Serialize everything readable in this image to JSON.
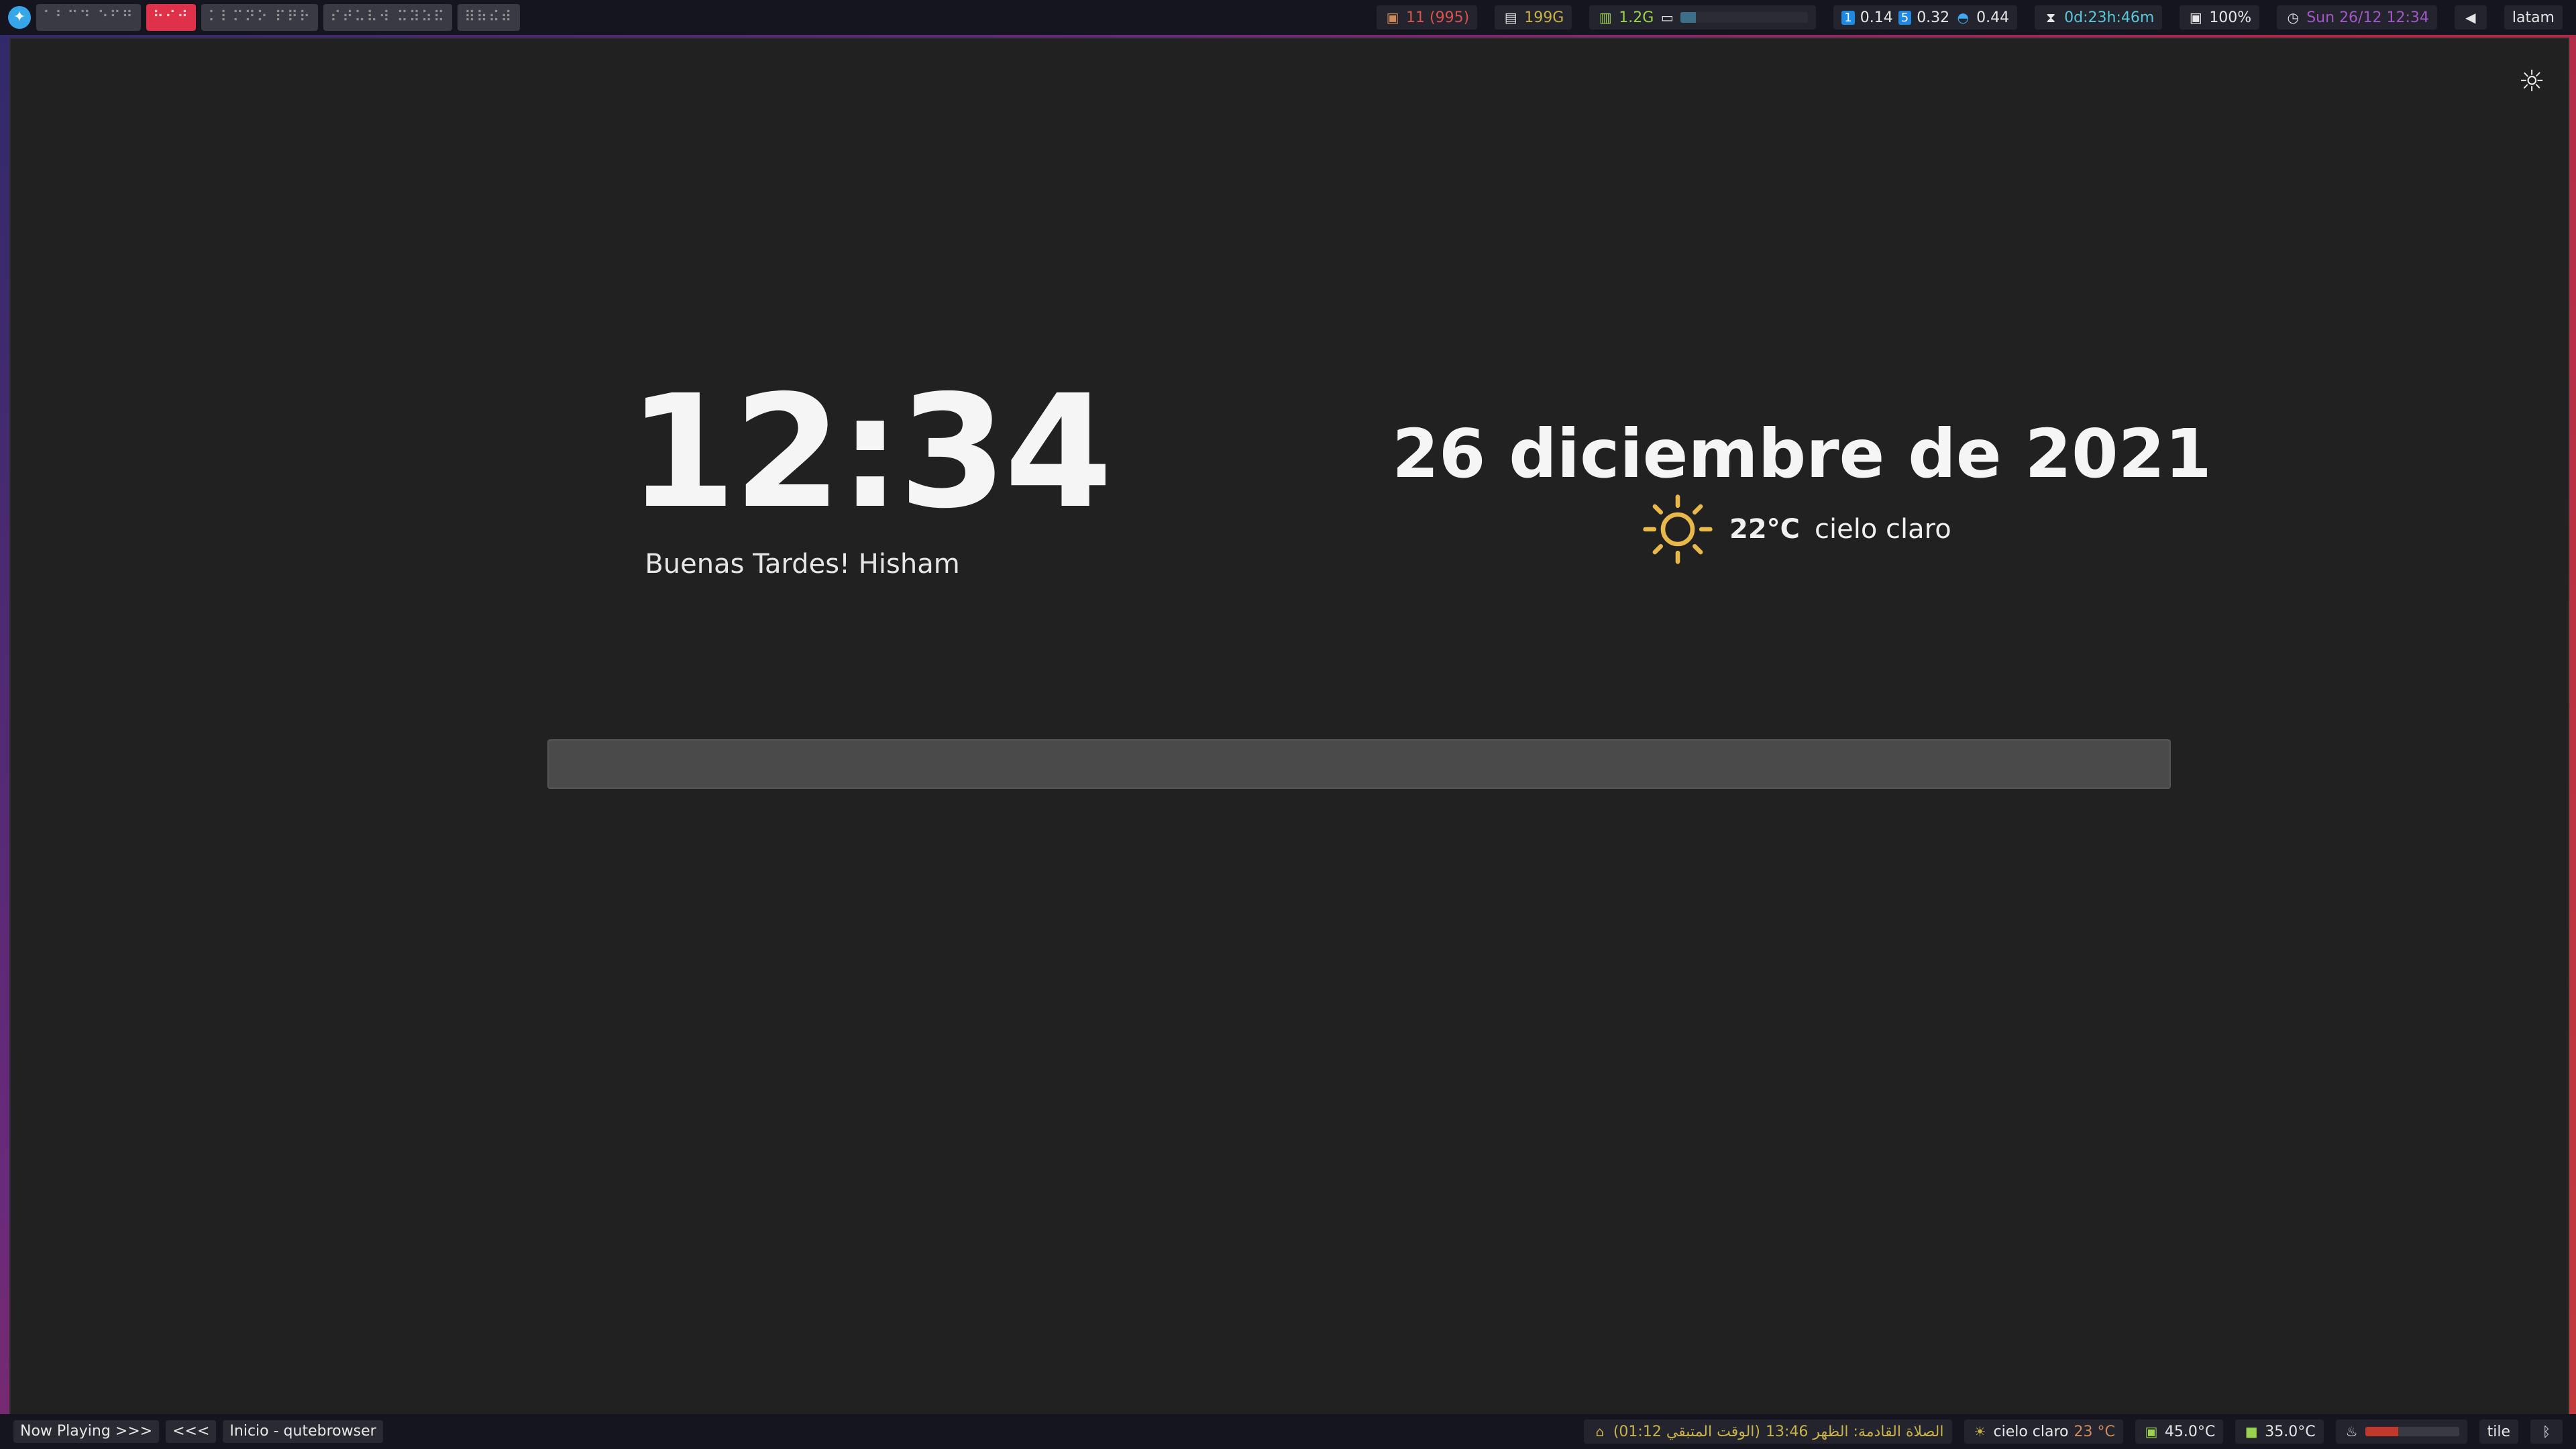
{
  "topbar": {
    "logo_icon": "qtile-logo-icon",
    "workspaces": [
      {
        "label": "⠁⠃⠉⠙ ⠑⠋⠛",
        "active": false
      },
      {
        "label": "⠓⠊⠚",
        "active": true
      },
      {
        "label": "⠅⠇⠍⠝⠕ ⠏⠟⠗",
        "active": false
      },
      {
        "label": "⠎⠞⠥⠧⠺ ⠭⠽⠵⠯",
        "active": false
      },
      {
        "label": "⠿⠷⠮⠾",
        "active": false
      }
    ],
    "updates": "11 (995)",
    "disk": "199G",
    "ram": "1.2G",
    "ram_usage_fraction": 0.12,
    "load": {
      "one_min_badge": "1",
      "one_min": "0.14",
      "five_min_badge": "5",
      "five_min": "0.32",
      "fifteen_min": "0.44"
    },
    "uptime": "0d:23h:46m",
    "brightness": "100%",
    "clock": "Sun 26/12 12:34",
    "layout": "latam"
  },
  "newtab": {
    "clock": "12:34",
    "greeting": "Buenas Tardes! Hisham",
    "date": "26 diciembre de 2021",
    "weather_temp": "22°C",
    "weather_desc": "cielo claro",
    "search_placeholder": ""
  },
  "bottombar": {
    "now_playing": "Now Playing >>>",
    "prev": "<<<",
    "window_title": "Inicio - qutebrowser",
    "prayer_remaining": "(الوقت المتبقي 01:12)",
    "prayer_next": "الصلاة القادمة: الظهر 13:46",
    "weather": "cielo claro",
    "weather_temp": "23 °C",
    "cpu_temp": "45.0°C",
    "gpu_temp": "35.0°C",
    "temp_fraction": 0.35,
    "layout_mode": "tile"
  },
  "colors": {
    "window_bg": "#212121",
    "bar_bg": "#151520",
    "accent_red": "#e0314a",
    "sun": "#e8b84a"
  }
}
